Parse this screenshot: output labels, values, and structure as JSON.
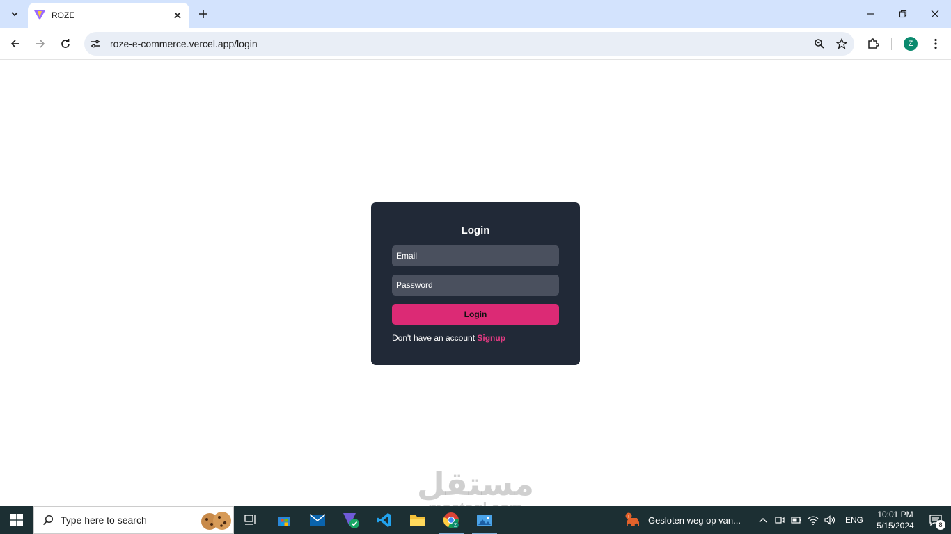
{
  "browser": {
    "tab_title": "ROZE",
    "url": "roze-e-commerce.vercel.app/login",
    "profile_initial": "Z"
  },
  "login": {
    "title": "Login",
    "email_placeholder": "Email",
    "password_placeholder": "Password",
    "button_label": "Login",
    "signup_prompt": "Don't have an account",
    "signup_link": "Signup"
  },
  "watermark": {
    "arabic": "مستقل",
    "latin": "mostaql.com"
  },
  "taskbar": {
    "search_placeholder": "Type here to search",
    "weather_text": "Gesloten weg op van...",
    "language": "ENG",
    "time": "10:01 PM",
    "date": "5/15/2024",
    "notification_count": "8"
  },
  "colors": {
    "card_bg": "#212937",
    "field_bg": "#4a505e",
    "accent": "#dc2a75",
    "tabstrip": "#d3e3fd",
    "taskbar": "#1c2f33"
  }
}
